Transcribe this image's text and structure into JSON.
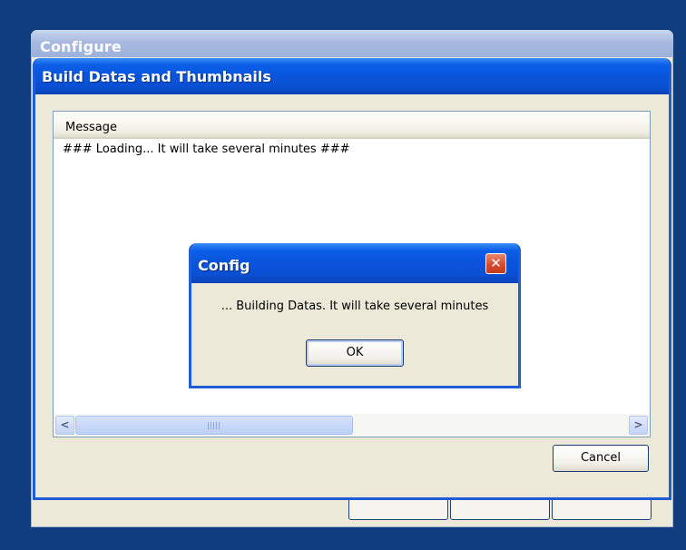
{
  "background_window": {
    "title": "Configure"
  },
  "main_window": {
    "title": "Build Datas and Thumbnails",
    "list": {
      "column_header": "Message",
      "rows": [
        "### Loading... It will take several minutes ###"
      ]
    },
    "scrollbar": {
      "left_arrow": "<",
      "right_arrow": ">"
    },
    "cancel_label": "Cancel"
  },
  "modal": {
    "title": "Config",
    "close_glyph": "✕",
    "message": "... Building Datas. It will take several minutes",
    "ok_label": "OK"
  },
  "colors": {
    "desktop": "#0f3d7d",
    "titlebar_blue": "#0a54db",
    "dialog_face": "#ece9d8",
    "close_red": "#d8482a"
  }
}
